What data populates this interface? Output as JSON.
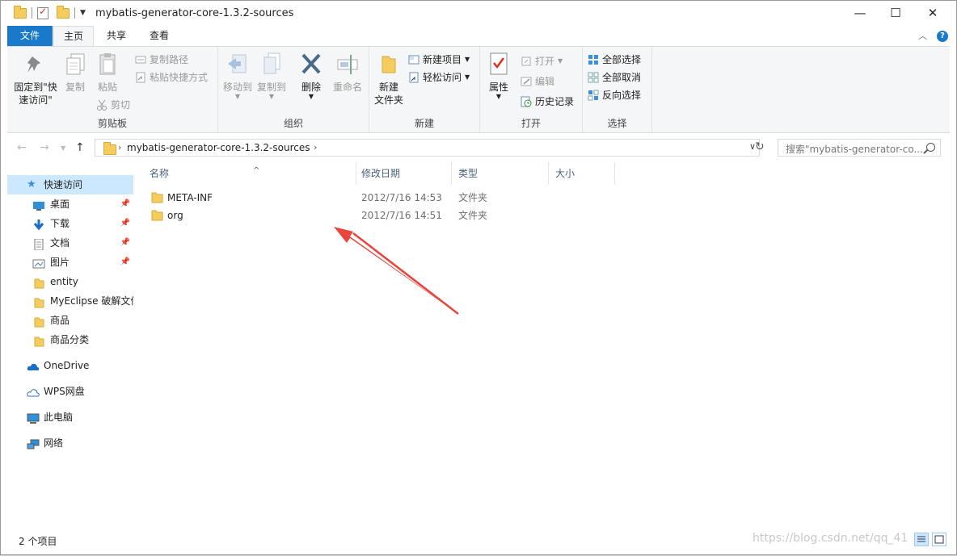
{
  "window": {
    "title": "mybatis-generator-core-1.3.2-sources"
  },
  "ribbon_tabs": {
    "file": "文件",
    "home": "主页",
    "share": "共享",
    "view": "查看"
  },
  "ribbon": {
    "clipboard": {
      "label": "剪贴板",
      "pin_line1": "固定到\"快",
      "pin_line2": "速访问\"",
      "copy": "复制",
      "paste": "粘贴",
      "copy_path": "复制路径",
      "paste_shortcut": "粘贴快捷方式",
      "cut": "剪切"
    },
    "organize": {
      "label": "组织",
      "move_to": "移动到",
      "copy_to": "复制到",
      "delete": "删除",
      "rename": "重命名"
    },
    "new": {
      "label": "新建",
      "new_folder_line1": "新建",
      "new_folder_line2": "文件夹",
      "new_item": "新建项目",
      "easy_access": "轻松访问"
    },
    "open": {
      "label": "打开",
      "properties": "属性",
      "open": "打开",
      "edit": "编辑",
      "history": "历史记录"
    },
    "select": {
      "label": "选择",
      "select_all": "全部选择",
      "select_none": "全部取消",
      "invert": "反向选择"
    }
  },
  "address": {
    "path": "mybatis-generator-core-1.3.2-sources",
    "search_placeholder": "搜索\"mybatis-generator-co..."
  },
  "nav": {
    "quick_access": "快速访问",
    "items": [
      {
        "label": "桌面",
        "pinned": true,
        "icon": "desktop-icon"
      },
      {
        "label": "下载",
        "pinned": true,
        "icon": "download-icon"
      },
      {
        "label": "文档",
        "pinned": true,
        "icon": "document-icon"
      },
      {
        "label": "图片",
        "pinned": true,
        "icon": "picture-icon"
      },
      {
        "label": "entity",
        "pinned": false,
        "icon": "folder-icon"
      },
      {
        "label": "MyEclipse 破解文件",
        "pinned": false,
        "icon": "folder-icon"
      },
      {
        "label": "商品",
        "pinned": false,
        "icon": "folder-icon"
      },
      {
        "label": "商品分类",
        "pinned": false,
        "icon": "folder-icon"
      }
    ],
    "onedrive": "OneDrive",
    "wps": "WPS网盘",
    "this_pc": "此电脑",
    "network": "网络"
  },
  "columns": {
    "name": "名称",
    "modified": "修改日期",
    "type": "类型",
    "size": "大小"
  },
  "files": [
    {
      "name": "META-INF",
      "modified": "2012/7/16 14:53",
      "type": "文件夹"
    },
    {
      "name": "org",
      "modified": "2012/7/16 14:51",
      "type": "文件夹"
    }
  ],
  "status": {
    "count": "2 个项目",
    "watermark": "https://blog.csdn.net/qq_41"
  },
  "colors": {
    "accent": "#1979ca",
    "arrow": "#e8453c",
    "selected": "#cce8ff"
  }
}
